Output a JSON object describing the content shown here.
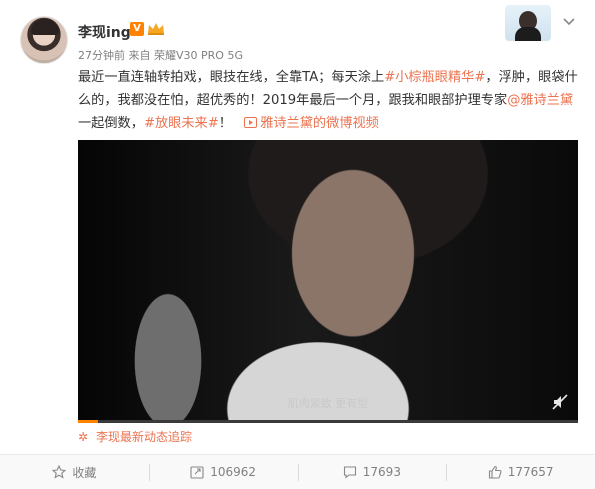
{
  "author": {
    "name": "李现ing",
    "vip_label": "V"
  },
  "meta": {
    "time": "27分钟前",
    "source": "来自 荣耀V30 PRO 5G"
  },
  "post": {
    "t1": "最近一直连轴转拍戏，眼技在线，全靠TA；每天涂上",
    "tag1": "#小棕瓶眼精华#",
    "t2": "，浮肿，眼袋什么的，我都没在怕，超优秀的！2019年最后一个月，跟我和眼部护理专家",
    "mention": "@雅诗兰黛",
    "t3": " 一起倒数，",
    "tag2": "#放眼未来#",
    "t4": "！",
    "video_link": "雅诗兰黛的微博视频"
  },
  "video": {
    "subtitle": "肌肉紧致 更有型",
    "progress": 0.04
  },
  "footer_source": "李现最新动态追踪",
  "actions": {
    "favorite": "收藏",
    "repost": "106962",
    "comment": "17693",
    "like": "177657"
  },
  "colors": {
    "accent": "#eb7350",
    "vip": "#ff8200"
  }
}
